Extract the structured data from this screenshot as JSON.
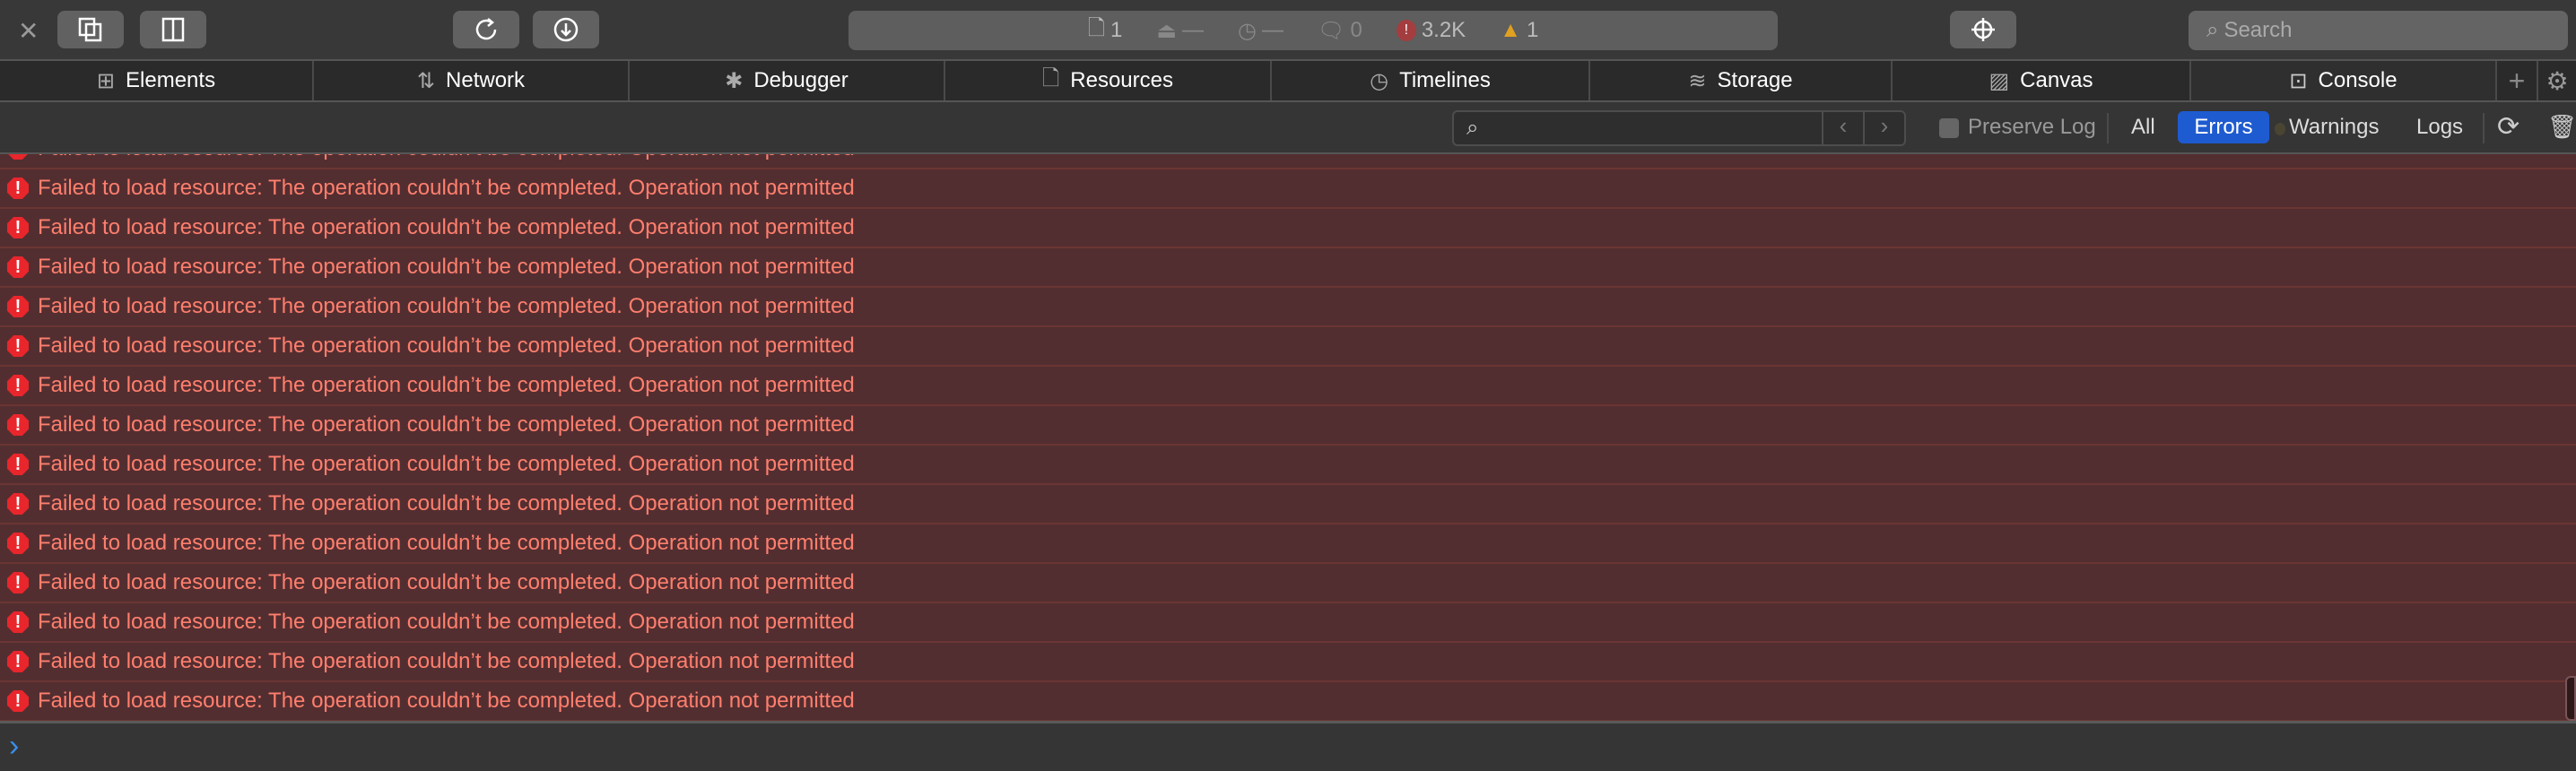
{
  "toolbar": {
    "search_placeholder": "Search"
  },
  "status": {
    "resources": "1",
    "size": "—",
    "time": "—",
    "messages": "0",
    "errors": "3.2K",
    "warnings": "1"
  },
  "tabs": [
    "Elements",
    "Network",
    "Debugger",
    "Resources",
    "Timelines",
    "Storage",
    "Canvas",
    "Console"
  ],
  "filter": {
    "preserve_log": "Preserve Log",
    "all": "All",
    "errors": "Errors",
    "warnings": "Warnings",
    "logs": "Logs",
    "active": "Errors",
    "active_color": "#1e5bd0"
  },
  "messages": [
    "Failed to load resource: The operation couldn’t be completed. Operation not permitted",
    "Failed to load resource: The operation couldn’t be completed. Operation not permitted",
    "Failed to load resource: The operation couldn’t be completed. Operation not permitted",
    "Failed to load resource: The operation couldn’t be completed. Operation not permitted",
    "Failed to load resource: The operation couldn’t be completed. Operation not permitted",
    "Failed to load resource: The operation couldn’t be completed. Operation not permitted",
    "Failed to load resource: The operation couldn’t be completed. Operation not permitted",
    "Failed to load resource: The operation couldn’t be completed. Operation not permitted",
    "Failed to load resource: The operation couldn’t be completed. Operation not permitted",
    "Failed to load resource: The operation couldn’t be completed. Operation not permitted",
    "Failed to load resource: The operation couldn’t be completed. Operation not permitted",
    "Failed to load resource: The operation couldn’t be completed. Operation not permitted",
    "Failed to load resource: The operation couldn’t be completed. Operation not permitted",
    "Failed to load resource: The operation couldn’t be completed. Operation not permitted",
    "Failed to load resource: The operation couldn’t be completed. Operation not permitted"
  ],
  "prompt": {
    "symbol": "›"
  }
}
